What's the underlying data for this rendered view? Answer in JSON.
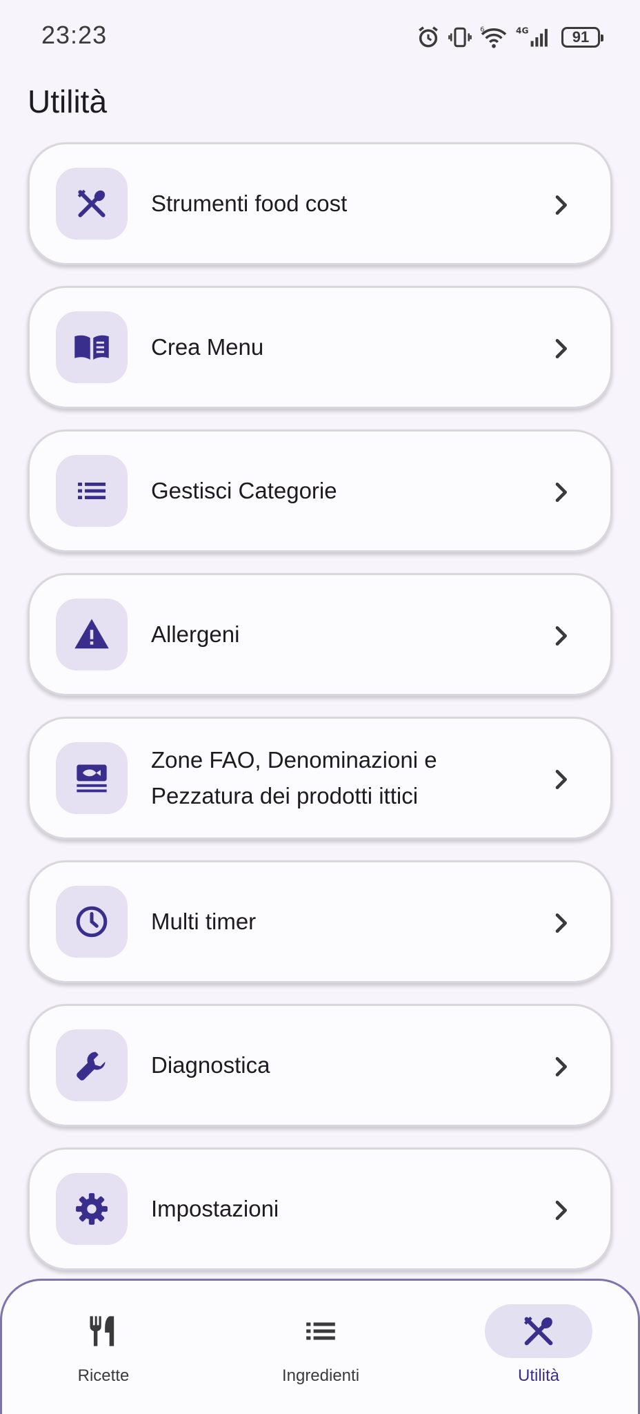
{
  "status_bar": {
    "time": "23:23",
    "battery": "91",
    "network": "4G",
    "wifi_tag": "6"
  },
  "page": {
    "title": "Utilità"
  },
  "menu": [
    {
      "label": "Strumenti food cost",
      "icon": "utensils-crossed-icon"
    },
    {
      "label": "Crea Menu",
      "icon": "open-book-icon"
    },
    {
      "label": "Gestisci Categorie",
      "icon": "list-icon"
    },
    {
      "label": "Allergeni",
      "icon": "warning-icon"
    },
    {
      "label": "Zone FAO, Denominazioni e Pezzatura dei prodotti ittici",
      "icon": "fish-icon"
    },
    {
      "label": "Multi timer",
      "icon": "clock-icon"
    },
    {
      "label": "Diagnostica",
      "icon": "wrench-icon"
    },
    {
      "label": "Impostazioni",
      "icon": "gear-icon"
    }
  ],
  "bottom_nav": [
    {
      "label": "Ricette",
      "icon": "fork-knife-icon",
      "active": false
    },
    {
      "label": "Ingredienti",
      "icon": "list-icon",
      "active": false
    },
    {
      "label": "Utilità",
      "icon": "utensils-crossed-icon",
      "active": true
    }
  ],
  "colors": {
    "accent": "#3a2e8c",
    "icon_bg": "#e5e1f2",
    "background": "#f7f5fb",
    "card": "#fcfbfe"
  }
}
